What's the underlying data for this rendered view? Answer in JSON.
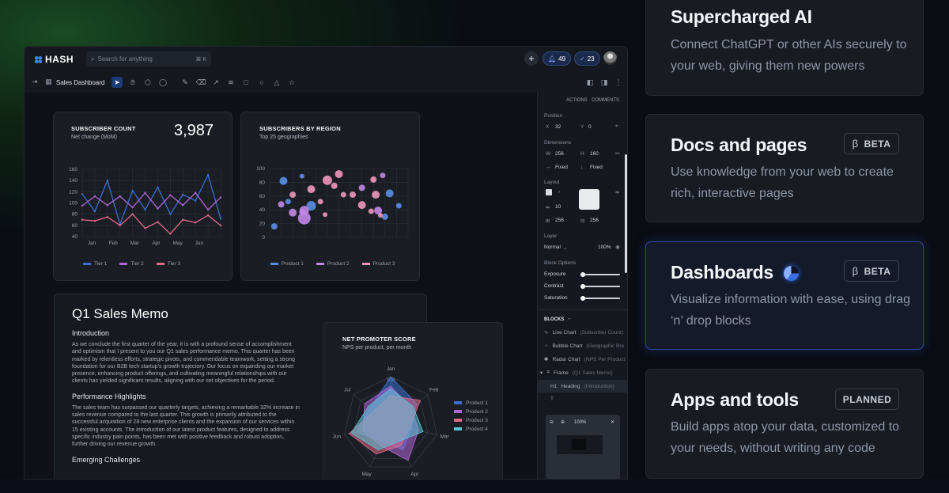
{
  "app": {
    "logo_text": "HASH",
    "search_placeholder": "Search for anything",
    "search_shortcut": "⌘ K",
    "notifications_count": "49",
    "tasks_count": "23",
    "breadcrumb": "Sales Dashboard"
  },
  "subscriber_card": {
    "title": "SUBSCRIBER COUNT",
    "subtitle": "Net change (MoM)",
    "value": "3,987"
  },
  "region_card": {
    "title": "SUBSCRIBERS BY REGION",
    "subtitle": "Top 25 geographies"
  },
  "memo": {
    "title": "Q1 Sales Memo",
    "sections": [
      {
        "heading": "Introduction",
        "body": "As we conclude the first quarter of the year, it is with a profound sense of accomplishment and optimism that I present to you our Q1 sales performance memo. This quarter has been marked by relentless efforts, strategic pivots, and commendable teamwork, setting a strong foundation for our B2B tech startup's growth trajectory. Our focus on expanding our market presence, enhancing product offerings, and cultivating meaningful relationships with our clients has yielded significant results, aligning with our set objectives for the period."
      },
      {
        "heading": "Performance Highlights",
        "body": "The sales team has surpassed our quarterly targets, achieving a remarkable 32% increase in sales revenue compared to the last quarter. This growth is primarily attributed to the successful acquisition of 28 new enterprise clients and the expansion of our services within 15 existing accounts. The introduction of our latest product features, designed to address specific industry pain points, has been met with positive feedback and robust adoption, further driving our revenue growth."
      },
      {
        "heading": "Emerging Challenges",
        "body": ""
      }
    ]
  },
  "nps_card": {
    "title": "NET PROMOTER SCORE",
    "subtitle": "NPS per product, per month"
  },
  "properties": {
    "tab_actions": "ACTIONS",
    "tab_comments": "COMMENTS",
    "position_label": "Position",
    "x_label": "X",
    "x_value": "32",
    "y_label": "Y",
    "y_value": "0",
    "dimensions_label": "Dimensions",
    "w_label": "W",
    "w_value": "256",
    "h_label": "H",
    "h_value": "160",
    "w_mode": "Fixed",
    "h_mode": "Fixed",
    "layout_label": "Layout",
    "gap_value": "10",
    "pad_w": "256",
    "pad_h": "256",
    "layer_label": "Layer",
    "blend_mode": "Normal",
    "opacity": "100%",
    "block_options_label": "Block Options",
    "exposure_label": "Exposure",
    "contrast_label": "Contrast",
    "saturation_label": "Saturation",
    "blocks_label": "BLOCKS",
    "blocks": [
      {
        "name": "Line Chart",
        "detail": "(Subscriber Count)"
      },
      {
        "name": "Bubble Chart",
        "detail": "(Geographic Bre"
      },
      {
        "name": "Radar Chart",
        "detail": "(NPS Per Product"
      },
      {
        "name": "Frame",
        "detail": "(Q1 Sales Memo)"
      },
      {
        "name": "Heading",
        "detail": "(Introduction)"
      }
    ],
    "minimap_zoom": "100%"
  },
  "features": [
    {
      "title": "Supercharged AI",
      "desc": "Connect ChatGPT or other AIs securely to your web, giving them new powers",
      "badge": ""
    },
    {
      "title": "Docs and pages",
      "desc": "Use knowledge from your web to create rich, interactive pages",
      "badge": "BETA",
      "badge_prefix": "β"
    },
    {
      "title": "Dashboards",
      "desc": "Visualize information with ease, using drag ‘n’ drop blocks",
      "badge": "BETA",
      "badge_prefix": "β"
    },
    {
      "title": "Apps and tools",
      "desc": "Build apps atop your data, customized to your needs, without writing any code",
      "badge": "PLANNED"
    }
  ],
  "chart_data": [
    {
      "type": "line",
      "title": "SUBSCRIBER COUNT",
      "categories": [
        "Jan",
        "Feb",
        "Mar",
        "Apr",
        "May",
        "Jun"
      ],
      "ylim": [
        40,
        160
      ],
      "yticks": [
        160,
        140,
        120,
        100,
        80,
        60,
        40
      ],
      "series": [
        {
          "name": "Tier 1",
          "color": "#3a6fd0",
          "values": [
            116,
            85,
            140,
            62,
            122,
            88,
            128,
            80,
            115,
            104,
            150,
            72
          ]
        },
        {
          "name": "Tier 2",
          "color": "#b066d8",
          "values": [
            95,
            112,
            96,
            112,
            92,
            118,
            90,
            114,
            96,
            118,
            88,
            110
          ]
        },
        {
          "name": "Tier 3",
          "color": "#e36a8a",
          "values": [
            70,
            68,
            75,
            60,
            80,
            55,
            66,
            45,
            70,
            65,
            78,
            60
          ]
        }
      ],
      "legend": "bottom"
    },
    {
      "type": "scatter",
      "title": "SUBSCRIBERS BY REGION",
      "ylim": [
        0,
        100
      ],
      "yticks": [
        100,
        80,
        60,
        40,
        20,
        0
      ],
      "series": [
        {
          "name": "Product 1",
          "color": "#5a8fe6",
          "points": [
            [
              2,
              16
            ],
            [
              6,
              82
            ],
            [
              8,
              52
            ],
            [
              14,
              89
            ],
            [
              18,
              46
            ],
            [
              50,
              30
            ],
            [
              52,
              64
            ],
            [
              56,
              46
            ]
          ]
        },
        {
          "name": "Product 2",
          "color": "#c288e8",
          "points": [
            [
              5,
              48
            ],
            [
              10,
              36
            ],
            [
              14,
              37
            ],
            [
              15,
              28
            ],
            [
              15,
              39
            ],
            [
              40,
              72
            ],
            [
              47,
              39
            ],
            [
              49,
              90
            ]
          ]
        },
        {
          "name": "Product 3",
          "color": "#f097b9",
          "points": [
            [
              10,
              62
            ],
            [
              18,
              70
            ],
            [
              22,
              52
            ],
            [
              24,
              33
            ],
            [
              25,
              83
            ],
            [
              28,
              75
            ],
            [
              30,
              92
            ],
            [
              32,
              62
            ],
            [
              36,
              62
            ],
            [
              40,
              47
            ],
            [
              44,
              38
            ],
            [
              45,
              84
            ],
            [
              46,
              62
            ],
            [
              48,
              32
            ]
          ]
        }
      ],
      "legend": "bottom"
    },
    {
      "type": "radar",
      "title": "NET PROMOTER SCORE",
      "categories": [
        "Jan",
        "Feb",
        "Mar",
        "Apr",
        "May",
        "Jun",
        "Jul"
      ],
      "rlim": [
        0,
        100
      ],
      "rtick": "100",
      "series": [
        {
          "name": "Product 1",
          "color": "#3a6fd0",
          "values": [
            100,
            70,
            45,
            60,
            40,
            75,
            55
          ]
        },
        {
          "name": "Product 2",
          "color": "#b066d8",
          "values": [
            80,
            55,
            60,
            85,
            50,
            60,
            70
          ]
        },
        {
          "name": "Product 3",
          "color": "#e36a8a",
          "values": [
            60,
            80,
            40,
            50,
            70,
            90,
            45
          ]
        },
        {
          "name": "Product 4",
          "color": "#5ec4d6",
          "values": [
            75,
            60,
            70,
            40,
            60,
            85,
            60
          ]
        }
      ],
      "legend": "right"
    }
  ]
}
